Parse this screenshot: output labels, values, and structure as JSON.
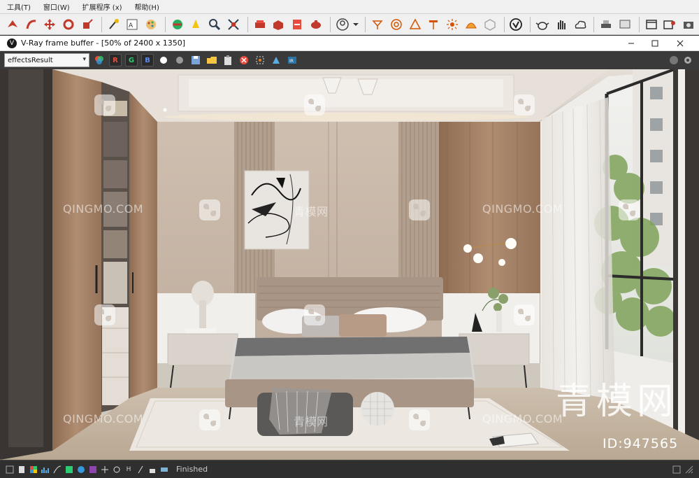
{
  "menubar": {
    "items": [
      "工具(T)",
      "窗口(W)",
      "扩展程序 (x)",
      "帮助(H)"
    ]
  },
  "toolbar": {
    "icons": [
      "select-icon",
      "bend-icon",
      "move-icon",
      "rotate-icon",
      "scale-icon",
      "pick-icon",
      "text-icon",
      "paint-icon",
      "render-icon",
      "light-icon",
      "zoom-icon",
      "fit-icon",
      "sofa-icon",
      "box-icon",
      "plane-icon",
      "teapot-icon",
      "user-icon",
      "lamp-icon",
      "target-icon",
      "cone-icon",
      "stool-icon",
      "sun-icon",
      "dome-icon",
      "cube-icon",
      "vray-icon",
      "kettle-icon",
      "hand-icon",
      "cloud-icon",
      "print-icon",
      "screen-icon",
      "window-icon",
      "frame-icon",
      "camera-icon"
    ]
  },
  "vfb": {
    "title": "V-Ray frame buffer - [50% of 2400 x 1350]",
    "channel": "effectsResult",
    "r_label": "R",
    "g_label": "G",
    "b_label": "B",
    "status": "Finished"
  },
  "watermark": {
    "latin": "QINGMO.COM",
    "cjk": "青模网",
    "big": "青模网",
    "id": "ID:947565"
  },
  "colors": {
    "vfb_bg": "#3a3a3a",
    "wall": "#c9b7a6",
    "wood": "#a58468"
  }
}
